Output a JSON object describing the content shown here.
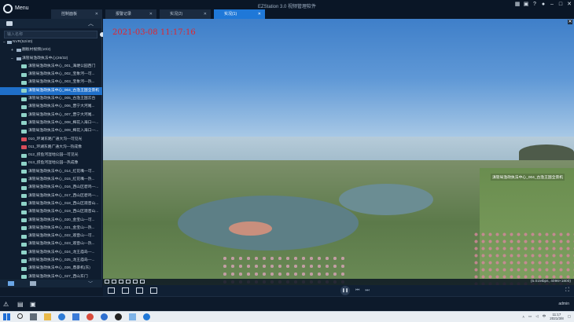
{
  "app": {
    "title": "EZStation 3.0 视频管理软件",
    "menu_label": "Menu"
  },
  "tabs": [
    {
      "label": "控制面板",
      "active": false
    },
    {
      "label": "报警记录",
      "active": false
    },
    {
      "label": "实况(2)",
      "active": false
    },
    {
      "label": "实况(1)",
      "active": true
    }
  ],
  "sidebar": {
    "search_placeholder": "输入名称",
    "tree": [
      {
        "label": "NVR(52/40)",
        "level": 0,
        "expanded": true
      },
      {
        "label": "翻板村视频(10/2)",
        "level": 1,
        "expanded": false
      },
      {
        "label": "滇管局渔政执法中心(26/32)",
        "level": 1,
        "expanded": true
      },
      {
        "label": "滇管局渔政执法中心_001_海埂公园西门",
        "status": "online"
      },
      {
        "label": "滇管局渔政执法中心_002_宝象河—可...",
        "status": "online"
      },
      {
        "label": "滇管局渔政执法中心_003_宝象河—热...",
        "status": "online"
      },
      {
        "label": "滇管局渔政执法中心_004_古渔王国全景机",
        "status": "online",
        "selected": true
      },
      {
        "label": "滇管局渔政执法中心_005_古渔王国云台",
        "status": "online"
      },
      {
        "label": "滇管局渔政执法中心_006_晋宁大河尾...",
        "status": "online"
      },
      {
        "label": "滇管局渔政执法中心_007_晋宁大河尾...",
        "status": "online"
      },
      {
        "label": "滇管局渔政执法中心_008_梅花入海口—...",
        "status": "online"
      },
      {
        "label": "滇管局渔政执法中心_009_梅花入海口—...",
        "status": "online"
      },
      {
        "label": "010_环湖东路广通大沟—可见光",
        "status": "offline"
      },
      {
        "label": "011_环湖东路广通大沟—热成像",
        "status": "offline"
      },
      {
        "label": "012_捞鱼河湿地公园—可见光",
        "status": "online"
      },
      {
        "label": "013_捞鱼河湿地公园—热成像",
        "status": "online"
      },
      {
        "label": "滇管局渔政执法中心_014_红花嘴—可...",
        "status": "online"
      },
      {
        "label": "滇管局渔政执法中心_015_红花嘴—热...",
        "status": "online"
      },
      {
        "label": "滇管局渔政执法中心_016_西山区碧鸡—...",
        "status": "online"
      },
      {
        "label": "滇管局渔政执法中心_017_西山区碧鸡—...",
        "status": "online"
      },
      {
        "label": "滇管局渔政执法中心_018_西山区观音山...",
        "status": "online"
      },
      {
        "label": "滇管局渔政执法中心_019_西山区观音山...",
        "status": "online"
      },
      {
        "label": "滇管局渔政执法中心_020_金宝山—可...",
        "status": "online"
      },
      {
        "label": "滇管局渔政执法中心_021_金宝山—热...",
        "status": "online"
      },
      {
        "label": "滇管局渔政执法中心_022_观音山—可...",
        "status": "online"
      },
      {
        "label": "滇管局渔政执法中心_023_观音山—热...",
        "status": "online"
      },
      {
        "label": "滇管局渔政执法中心_024_龙王庙岛—...",
        "status": "online"
      },
      {
        "label": "滇管局渔政执法中心_025_龙王庙岛—...",
        "status": "online"
      },
      {
        "label": "滇管局渔政执法中心_026_鼎豪机(东)",
        "status": "online"
      },
      {
        "label": "滇管局渔政执法中心_027_西山东门",
        "status": "online"
      }
    ]
  },
  "video": {
    "timestamp": "2021-03-08 11:17:16",
    "camera_label": "滇管局渔政执法中心_004_古渔王国全景机",
    "stats": "(5.01Mbps, 4096×1800)"
  },
  "footer": {
    "user": "admin"
  },
  "taskbar": {
    "time": "11:17",
    "date": "2021/3/8"
  },
  "colors": {
    "accent": "#1f78d8",
    "osd_time": "#e0262f",
    "selection": "#1f6fc9",
    "camera_online": "#8fd3c8",
    "camera_offline": "#d94d5a"
  }
}
